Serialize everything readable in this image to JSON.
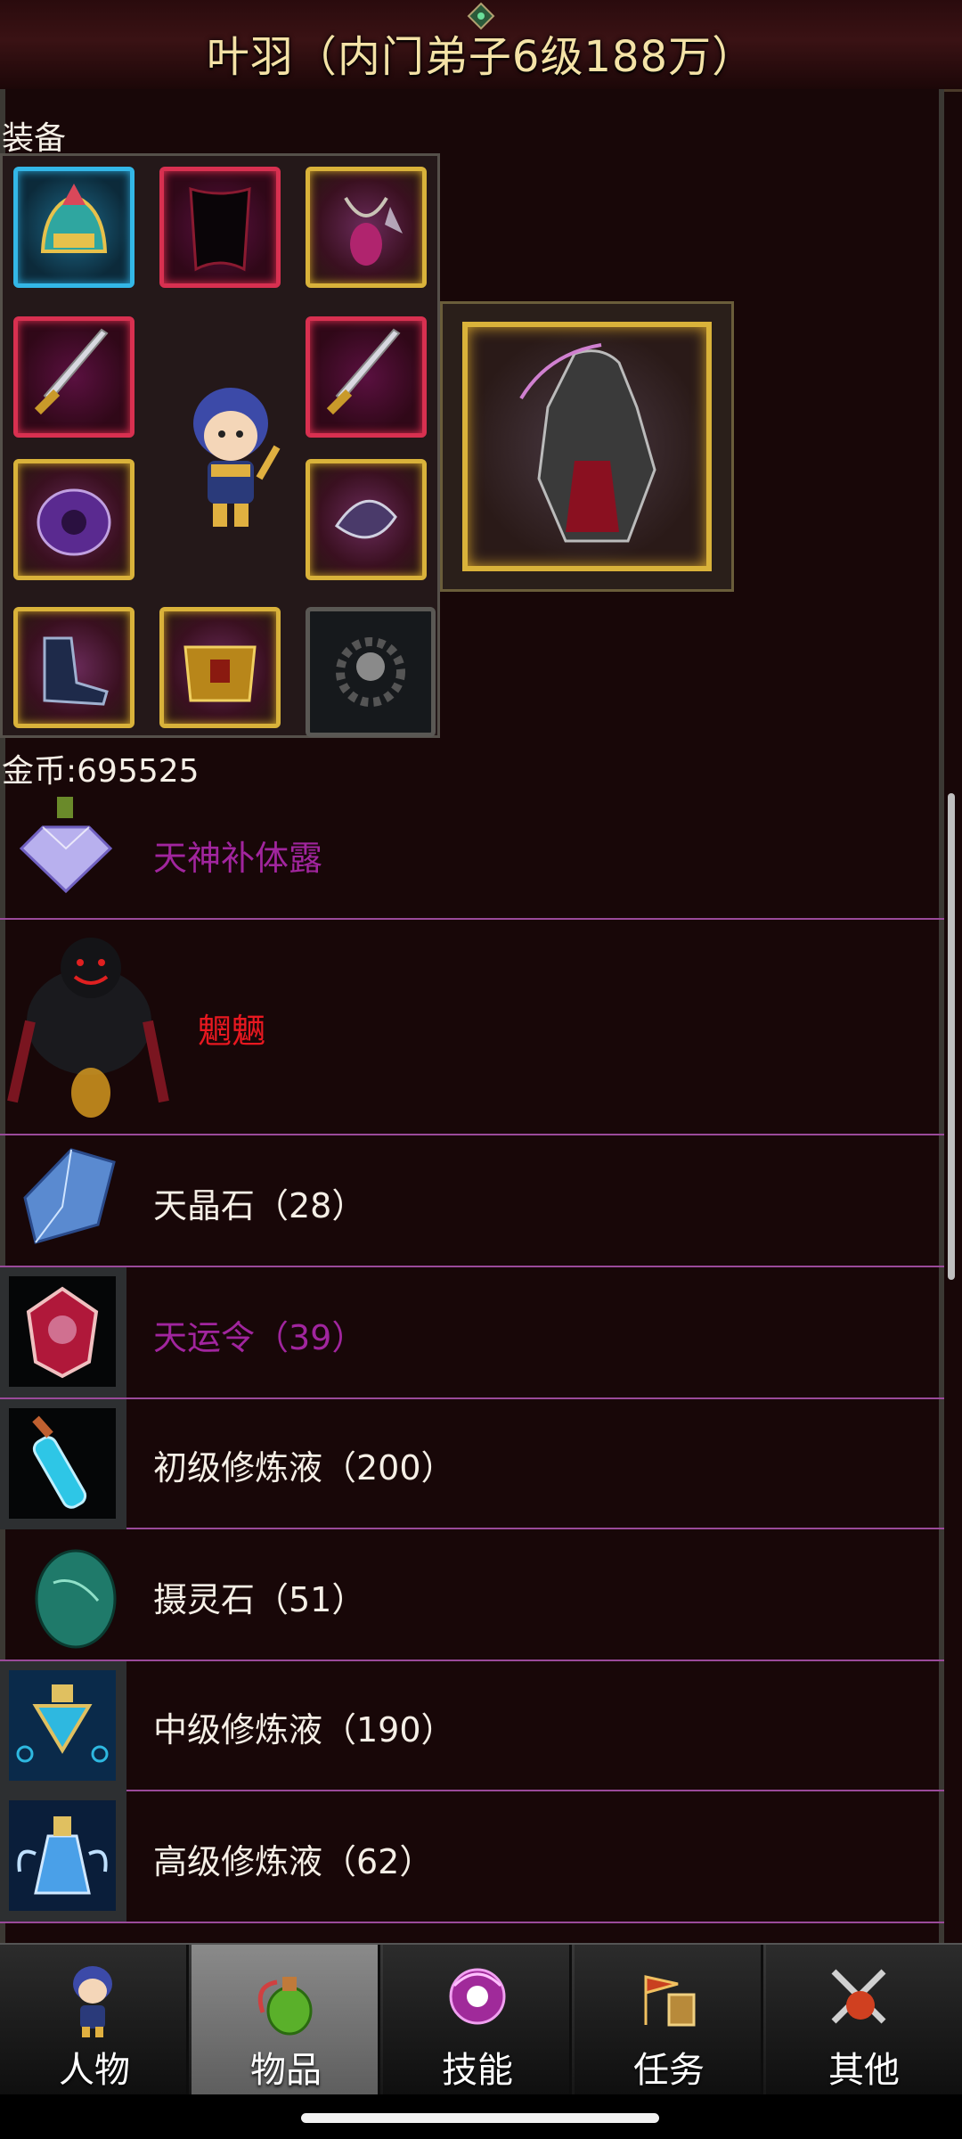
{
  "header": {
    "title": "叶羽（内门弟子6级188万）"
  },
  "equipment": {
    "section_label": "装备",
    "slots": [
      {
        "name": "helmet",
        "rarity": "cyan"
      },
      {
        "name": "cape",
        "rarity": "red"
      },
      {
        "name": "necklace",
        "rarity": "gold"
      },
      {
        "name": "weapon-left",
        "rarity": "red"
      },
      {
        "name": "weapon-right",
        "rarity": "red"
      },
      {
        "name": "armor",
        "rarity": "gold"
      },
      {
        "name": "bracer",
        "rarity": "gold"
      },
      {
        "name": "boots",
        "rarity": "gold"
      },
      {
        "name": "belt",
        "rarity": "gold"
      },
      {
        "name": "bead-bracelet",
        "rarity": "dark"
      }
    ],
    "mount_rarity": "gold"
  },
  "gold": {
    "label": "金币:695525"
  },
  "items": [
    {
      "name": "天神补体露",
      "color": "#a1259e",
      "icon": "diamond-potion-icon"
    },
    {
      "name": "魍魉",
      "color": "#e81820",
      "icon": "shadow-demon-icon"
    },
    {
      "name": "天晶石（28）",
      "color": "#f5efe6",
      "icon": "blue-crystal-icon"
    },
    {
      "name": "天运令（39）",
      "color": "#a1259e",
      "icon": "fortune-token-icon"
    },
    {
      "name": "初级修炼液（200）",
      "color": "#f5efe6",
      "icon": "blue-vial-icon"
    },
    {
      "name": "摄灵石（51）",
      "color": "#f5efe6",
      "icon": "green-egg-stone-icon"
    },
    {
      "name": "中级修炼液（190）",
      "color": "#f5efe6",
      "icon": "medium-potion-icon"
    },
    {
      "name": "高级修炼液（62）",
      "color": "#f5efe6",
      "icon": "winged-potion-icon"
    }
  ],
  "nav": {
    "tabs": [
      {
        "label": "人物",
        "icon": "character-icon",
        "active": false
      },
      {
        "label": "物品",
        "icon": "potion-bag-icon",
        "active": true
      },
      {
        "label": "技能",
        "icon": "skill-orb-icon",
        "active": false
      },
      {
        "label": "任务",
        "icon": "quest-flag-icon",
        "active": false
      },
      {
        "label": "其他",
        "icon": "crossed-swords-icon",
        "active": false
      }
    ]
  }
}
